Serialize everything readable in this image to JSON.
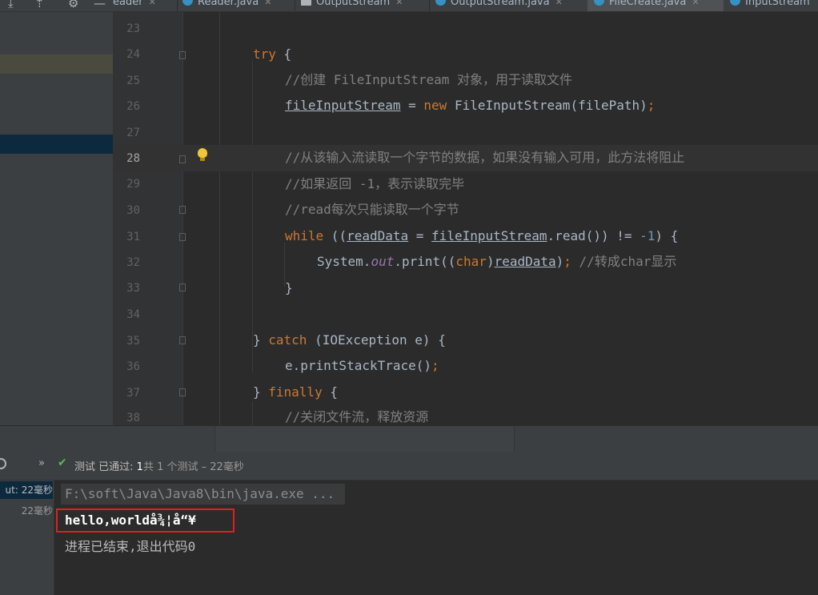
{
  "toolbar": {
    "icons": [
      "scroll-to-end-icon",
      "scroll-from-source-icon",
      "gear-icon",
      "minimize-icon"
    ]
  },
  "tabs": [
    {
      "label": "eader",
      "icon": "java-file-icon",
      "color": "#4fa3d8",
      "active": false
    },
    {
      "label": "Reader.java",
      "icon": "java-class-icon",
      "color": "#3592c4",
      "active": false
    },
    {
      "label": "OutputStream",
      "icon": "java-class-icon",
      "color": "#b0b3b5",
      "active": false
    },
    {
      "label": "OutputStream.java",
      "icon": "java-class-icon",
      "color": "#3592c4",
      "active": false
    },
    {
      "label": "FileCreate.java",
      "icon": "java-class-icon",
      "color": "#3592c4",
      "active": true
    },
    {
      "label": "InputStream",
      "icon": "java-class-icon",
      "color": "#3592c4",
      "active": false
    }
  ],
  "editor": {
    "line_numbers": [
      "23",
      "24",
      "25",
      "26",
      "27",
      "28",
      "29",
      "30",
      "31",
      "32",
      "33",
      "34",
      "35",
      "36",
      "37",
      "38"
    ],
    "current_line": "28",
    "code": {
      "l24_try": "try",
      "l24_brace": " {",
      "l25_comment": "//创建 FileInputStream 对象，用于读取文件",
      "l26_var": "fileInputStream",
      "l26_eq": " = ",
      "l26_new": "new",
      "l26_rest": " FileInputStream(filePath)",
      "l26_semi": ";",
      "l28_comment": "//从该输入流读取一个字节的数据，如果没有输入可用，此方法将阻止",
      "l29_comment": "//如果返回 -1，表示读取完毕",
      "l30_comment": "//read每次只能读取一个字节",
      "l31_while": "while",
      "l31_a": " ((",
      "l31_readData": "readData",
      "l31_b": " = ",
      "l31_fis": "fileInputStream",
      "l31_c": ".read()) != ",
      "l31_num": "-1",
      "l31_d": ") {",
      "l32_a": "System.",
      "l32_out": "out",
      "l32_b": ".print((",
      "l32_char": "char",
      "l32_c": ")",
      "l32_readData": "readData",
      "l32_d": ")",
      "l32_semi": ";",
      "l32_comment": " //转成char显示",
      "l33": "}",
      "l35_a": "} ",
      "l35_catch": "catch",
      "l35_b": " (IOException e) {",
      "l36_a": "e.printStackTrace()",
      "l36_semi": ";",
      "l37_a": "} ",
      "l37_finally": "finally",
      "l37_b": " {",
      "l38_comment": "//关闭文件流，释放资源"
    }
  },
  "status": {
    "expand_icon": "»",
    "check_icon": "✔",
    "label": "测试 已通过: ",
    "count": "1",
    "summary": "共 1 个测试 – 22毫秒"
  },
  "run_tree": [
    {
      "label": "ut: 22毫秒",
      "selected": true
    },
    {
      "label": "22毫秒",
      "selected": false
    }
  ],
  "console": {
    "command": "F:\\soft\\Java\\Java8\\bin\\java.exe ...",
    "output": "hello,worldå¾¦å“¥",
    "exit": "进程已结束,退出代码0"
  },
  "colors": {
    "highlight_box": "#e51c23",
    "keyword": "#cc7832",
    "comment": "#808080",
    "pass_green": "#5fb45f"
  }
}
